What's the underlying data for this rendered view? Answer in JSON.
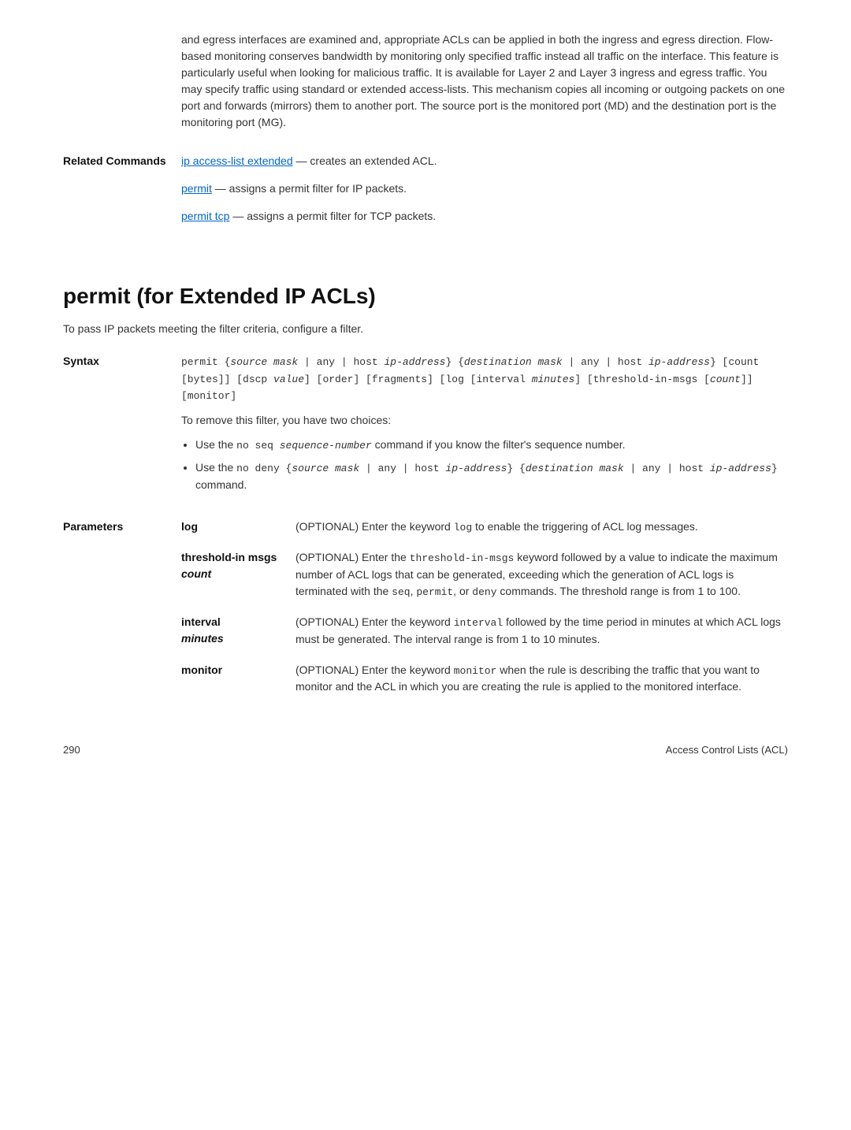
{
  "description_tail": "and egress interfaces are examined and, appropriate ACLs can be applied in both the ingress and egress direction. Flow-based monitoring conserves bandwidth by monitoring only specified traffic instead all traffic on the interface. This feature is particularly useful when looking for malicious traffic. It is available for Layer 2 and Layer 3 ingress and egress traffic. You may specify traffic using standard or extended access-lists. This mechanism copies all incoming or outgoing packets on one port and forwards (mirrors) them to another port. The source port is the monitored port (MD) and the destination port is the monitoring port (MG).",
  "related": {
    "label": "Related Commands",
    "items": [
      {
        "link": "ip access-list extended",
        "rest": " — creates an extended ACL."
      },
      {
        "link": "permit",
        "rest": " — assigns a permit filter for IP packets."
      },
      {
        "link": "permit tcp",
        "rest": " — assigns a permit filter for TCP packets."
      }
    ]
  },
  "section": {
    "heading": "permit (for Extended IP ACLs)",
    "intro": "To pass IP packets meeting the filter criteria, configure a filter.",
    "syntax_label": "Syntax",
    "syntax_lines": [
      "permit {source mask | any | host ip-address} {destination mask | any | host ip-address} [count [bytes]] [dscp value] [order] [fragments] [log [interval minutes] [threshold-in-msgs [count]] [monitor]"
    ],
    "syntax_note": "To remove this filter, you have two choices:",
    "bullets": [
      {
        "prefix": "Use the ",
        "code1": "no seq ",
        "italic1": "sequence-number",
        "suffix": " command if you know the filter's sequence number."
      },
      {
        "prefix": "Use the ",
        "code1": "no deny {",
        "italic1": "source mask",
        "code2": " | any | host ",
        "italic2": "ip-address",
        "code3": "} {",
        "italic3": "destination mask",
        "code4": " | any | host ",
        "italic4": "ip-address",
        "code5": "}",
        "suffix": " command."
      }
    ],
    "params_label": "Parameters",
    "params": [
      {
        "name": "log",
        "name_italic": "",
        "desc_pre": "(OPTIONAL) Enter the keyword ",
        "desc_code": "log",
        "desc_post": " to enable the triggering of ACL log messages."
      },
      {
        "name": "threshold-in msgs ",
        "name_italic": "count",
        "desc_pre": "(OPTIONAL) Enter the ",
        "desc_code": "threshold-in-msgs",
        "desc_post": " keyword followed by a value to indicate the maximum number of ACL logs that can be generated, exceeding which the generation of ACL logs is terminated with the ",
        "desc_code2": "seq",
        "desc_mid2": ", ",
        "desc_code3": "permit",
        "desc_mid3": ", or ",
        "desc_code4": "deny",
        "desc_post2": " commands. The threshold range is from 1 to 100."
      },
      {
        "name": "interval",
        "name_italic": "minutes",
        "name_br": true,
        "desc_pre": "(OPTIONAL) Enter the keyword ",
        "desc_code": "interval",
        "desc_post": " followed by the time period in minutes at which ACL logs must be generated. The interval range is from 1 to 10 minutes."
      },
      {
        "name": "monitor",
        "name_italic": "",
        "desc_pre": "(OPTIONAL) Enter the keyword ",
        "desc_code": "monitor",
        "desc_post": " when the rule is describing the traffic that you want to monitor and the ACL in which you are creating the rule is applied to the monitored interface."
      }
    ]
  },
  "footer": {
    "page": "290",
    "title": "Access Control Lists (ACL)"
  }
}
